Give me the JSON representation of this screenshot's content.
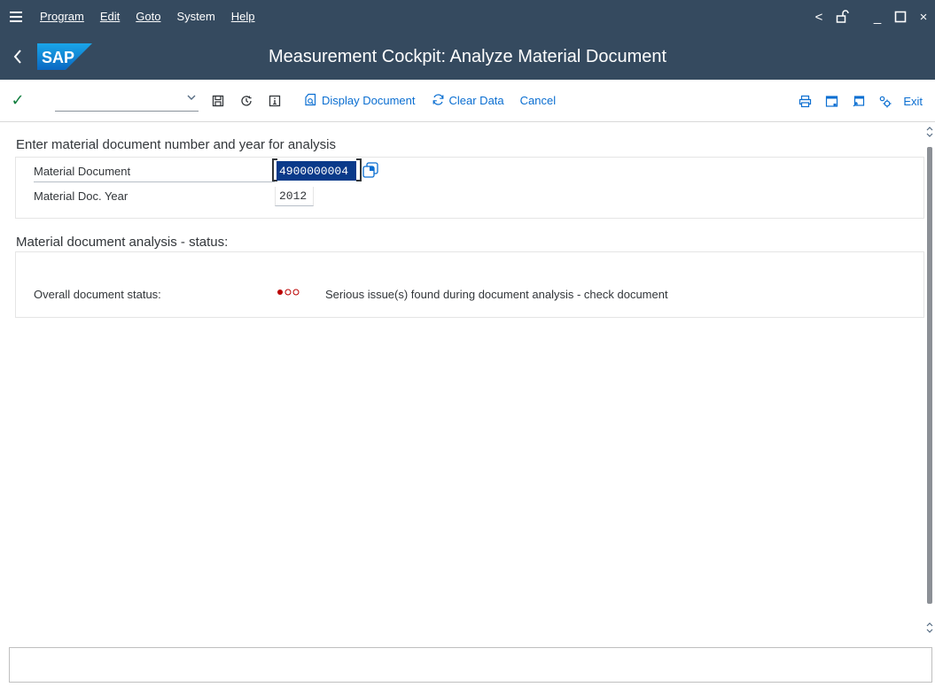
{
  "menu": {
    "items": [
      "Program",
      "Edit",
      "Goto",
      "System",
      "Help"
    ]
  },
  "window_controls": {
    "previous": "<",
    "minimize": "_",
    "maximize": "□",
    "close": "×"
  },
  "title": "Measurement Cockpit: Analyze Material Document",
  "logo_text": "SAP",
  "toolbar": {
    "command_field_value": "",
    "display_document_label": "Display Document",
    "clear_data_label": "Clear Data",
    "cancel_label": "Cancel",
    "exit_label": "Exit"
  },
  "selection": {
    "heading": "Enter material document number and year for analysis",
    "material_document_label": "Material Document",
    "material_document_value": "4900000004",
    "material_doc_year_label": "Material Doc. Year",
    "material_doc_year_value": "2012"
  },
  "analysis": {
    "heading": "Material document analysis - status:",
    "overall_status_label": "Overall document status:",
    "status_level": "1 of 3",
    "status_text": "Serious issue(s) found during document analysis - check document"
  },
  "status_bar": {
    "message": ""
  },
  "colors": {
    "shell_header": "#354a5f",
    "link_blue": "#0a6ed1",
    "selection_blue": "#0a3a8a",
    "error_red": "#bb0000",
    "ok_green": "#107e3e"
  }
}
